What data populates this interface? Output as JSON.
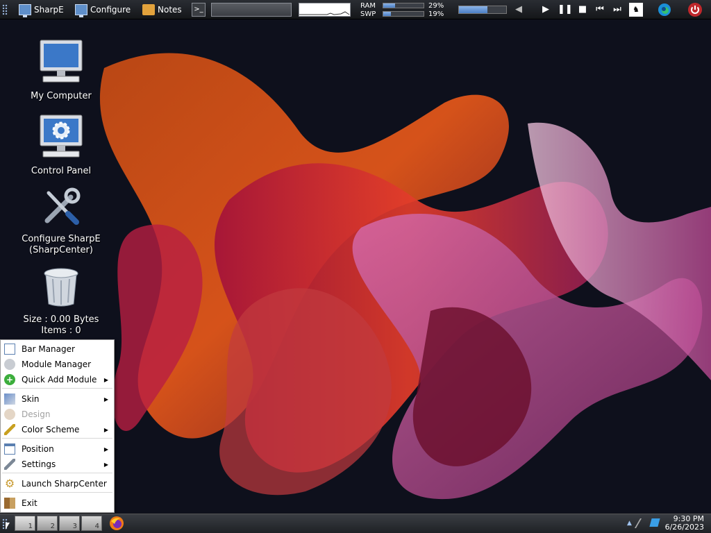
{
  "topbar": {
    "items": [
      {
        "label": "SharpE",
        "icon": "monitor-icon"
      },
      {
        "label": "Configure",
        "icon": "monitor-icon"
      },
      {
        "label": "Notes",
        "icon": "notes-icon"
      }
    ],
    "terminal_icon": "terminal-icon",
    "ram_label": "RAM",
    "swp_label": "SWP",
    "ram_percent": "29%",
    "swp_percent": "19%",
    "ram_fraction": 0.29,
    "swp_fraction": 0.19,
    "volume_fraction": 0.6,
    "media": [
      "play-icon",
      "pause-icon",
      "stop-icon",
      "previous-icon",
      "next-icon"
    ],
    "accent": "#4a7ec4"
  },
  "desktop": {
    "icons": [
      {
        "label": "My Computer"
      },
      {
        "label": "Control Panel"
      },
      {
        "label": "Configure SharpE\n(SharpCenter)"
      },
      {
        "label": "Size : 0.00 Bytes\nItems : 0"
      }
    ]
  },
  "menu": {
    "items": [
      {
        "label": "Bar Manager",
        "icon": "bar-manager-icon",
        "submenu": false
      },
      {
        "label": "Module Manager",
        "icon": "module-manager-icon",
        "submenu": false
      },
      {
        "label": "Quick Add Module",
        "icon": "add-icon",
        "submenu": true
      },
      {
        "label": "Skin",
        "icon": "skin-icon",
        "submenu": true
      },
      {
        "label": "Design",
        "icon": "design-icon",
        "submenu": false,
        "disabled": true
      },
      {
        "label": "Color Scheme",
        "icon": "color-scheme-icon",
        "submenu": true
      },
      {
        "label": "Position",
        "icon": "position-icon",
        "submenu": true
      },
      {
        "label": "Settings",
        "icon": "settings-icon",
        "submenu": true
      },
      {
        "label": "Launch SharpCenter",
        "icon": "gear-icon",
        "submenu": false
      },
      {
        "label": "Exit",
        "icon": "exit-icon",
        "submenu": false
      }
    ]
  },
  "taskbar": {
    "workspaces": [
      "1",
      "2",
      "3",
      "4"
    ],
    "time": "9:30 PM",
    "date": "6/26/2023"
  }
}
